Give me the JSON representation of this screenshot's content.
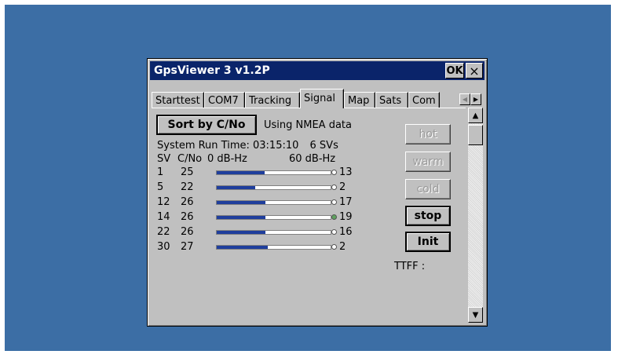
{
  "window": {
    "title": "GpsViewer 3 v1.2P",
    "ok_label": "OK",
    "close_label": "×"
  },
  "tabs": [
    {
      "label": "Starttest"
    },
    {
      "label": "COM7"
    },
    {
      "label": "Tracking"
    },
    {
      "label": "Signal",
      "active": true
    },
    {
      "label": "Map"
    },
    {
      "label": "Sats"
    },
    {
      "label": "Com"
    }
  ],
  "signal": {
    "sort_button": "Sort by C/No",
    "source_text": "Using NMEA data",
    "run_time_label": "System Run Time: 03:15:10",
    "sv_count": "6 SVs",
    "col_sv": "SV",
    "col_cno": "C/No",
    "scale_min": "0 dB-Hz",
    "scale_max": "60 dB-Hz",
    "rows": [
      {
        "sv": "1",
        "cno": "25",
        "count": "13",
        "fraction": 0.42
      },
      {
        "sv": "5",
        "cno": "22",
        "count": "2",
        "fraction": 0.34
      },
      {
        "sv": "12",
        "cno": "26",
        "count": "17",
        "fraction": 0.43
      },
      {
        "sv": "14",
        "cno": "26",
        "count": "19",
        "fraction": 0.43,
        "dot_color": "#5fa35f"
      },
      {
        "sv": "22",
        "cno": "26",
        "count": "16",
        "fraction": 0.43
      },
      {
        "sv": "30",
        "cno": "27",
        "count": "2",
        "fraction": 0.45
      }
    ],
    "ttff_label": "TTFF :"
  },
  "controls": {
    "hot": "hot",
    "warm": "warm",
    "cold": "cold",
    "stop": "stop",
    "init": "Init"
  },
  "colors": {
    "desktop": "#3c6ea5",
    "titlebar": "#0a246a",
    "bar_fill": "#1f3e9c"
  }
}
